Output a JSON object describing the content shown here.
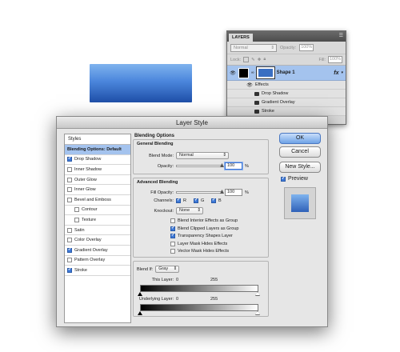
{
  "layers_panel": {
    "tab": "LAYERS",
    "mode": "Normal",
    "opacity_label": "Opacity:",
    "opacity_value": "100%",
    "lock_label": "Lock:",
    "fill_label": "Fill:",
    "fill_value": "100%",
    "layer_name": "Shape 1",
    "fx": "fx",
    "effects_label": "Effects",
    "effects": [
      "Drop Shadow",
      "Gradient Overlay",
      "Stroke"
    ]
  },
  "dialog": {
    "title": "Layer Style",
    "styles_header": "Styles",
    "styles": [
      {
        "label": "Blending Options: Default",
        "checkbox": false,
        "checked": false,
        "selected": true,
        "indent": false
      },
      {
        "label": "Drop Shadow",
        "checkbox": true,
        "checked": true,
        "selected": false,
        "indent": false
      },
      {
        "label": "Inner Shadow",
        "checkbox": true,
        "checked": false,
        "selected": false,
        "indent": false
      },
      {
        "label": "Outer Glow",
        "checkbox": true,
        "checked": false,
        "selected": false,
        "indent": false
      },
      {
        "label": "Inner Glow",
        "checkbox": true,
        "checked": false,
        "selected": false,
        "indent": false
      },
      {
        "label": "Bevel and Emboss",
        "checkbox": true,
        "checked": false,
        "selected": false,
        "indent": false
      },
      {
        "label": "Contour",
        "checkbox": true,
        "checked": false,
        "selected": false,
        "indent": true
      },
      {
        "label": "Texture",
        "checkbox": true,
        "checked": false,
        "selected": false,
        "indent": true
      },
      {
        "label": "Satin",
        "checkbox": true,
        "checked": false,
        "selected": false,
        "indent": false
      },
      {
        "label": "Color Overlay",
        "checkbox": true,
        "checked": false,
        "selected": false,
        "indent": false
      },
      {
        "label": "Gradient Overlay",
        "checkbox": true,
        "checked": true,
        "selected": false,
        "indent": false
      },
      {
        "label": "Pattern Overlay",
        "checkbox": true,
        "checked": false,
        "selected": false,
        "indent": false
      },
      {
        "label": "Stroke",
        "checkbox": true,
        "checked": true,
        "selected": false,
        "indent": false
      }
    ],
    "blending_options_title": "Blending Options",
    "general_blending": {
      "legend": "General Blending",
      "blend_mode_label": "Blend Mode:",
      "blend_mode": "Normal",
      "opacity_label": "Opacity:",
      "opacity_value": "100",
      "opacity_unit": "%"
    },
    "advanced_blending": {
      "legend": "Advanced Blending",
      "fill_opacity_label": "Fill Opacity:",
      "fill_opacity_value": "100",
      "fill_opacity_unit": "%",
      "channels_label": "Channels:",
      "channels": [
        "R",
        "G",
        "B"
      ],
      "knockout_label": "Knockout:",
      "knockout": "None",
      "options": [
        {
          "label": "Blend Interior Effects as Group",
          "checked": false
        },
        {
          "label": "Blend Clipped Layers as Group",
          "checked": true
        },
        {
          "label": "Transparency Shapes Layer",
          "checked": true
        },
        {
          "label": "Layer Mask Hides Effects",
          "checked": false
        },
        {
          "label": "Vector Mask Hides Effects",
          "checked": false
        }
      ]
    },
    "blend_if": {
      "label": "Blend If:",
      "value": "Gray",
      "this_layer_label": "This Layer:",
      "this_layer_min": "0",
      "this_layer_max": "255",
      "underlying_label": "Underlying Layer:",
      "underlying_min": "0",
      "underlying_max": "255"
    },
    "buttons": {
      "ok": "OK",
      "cancel": "Cancel",
      "new_style": "New Style..."
    },
    "preview_label": "Preview"
  }
}
